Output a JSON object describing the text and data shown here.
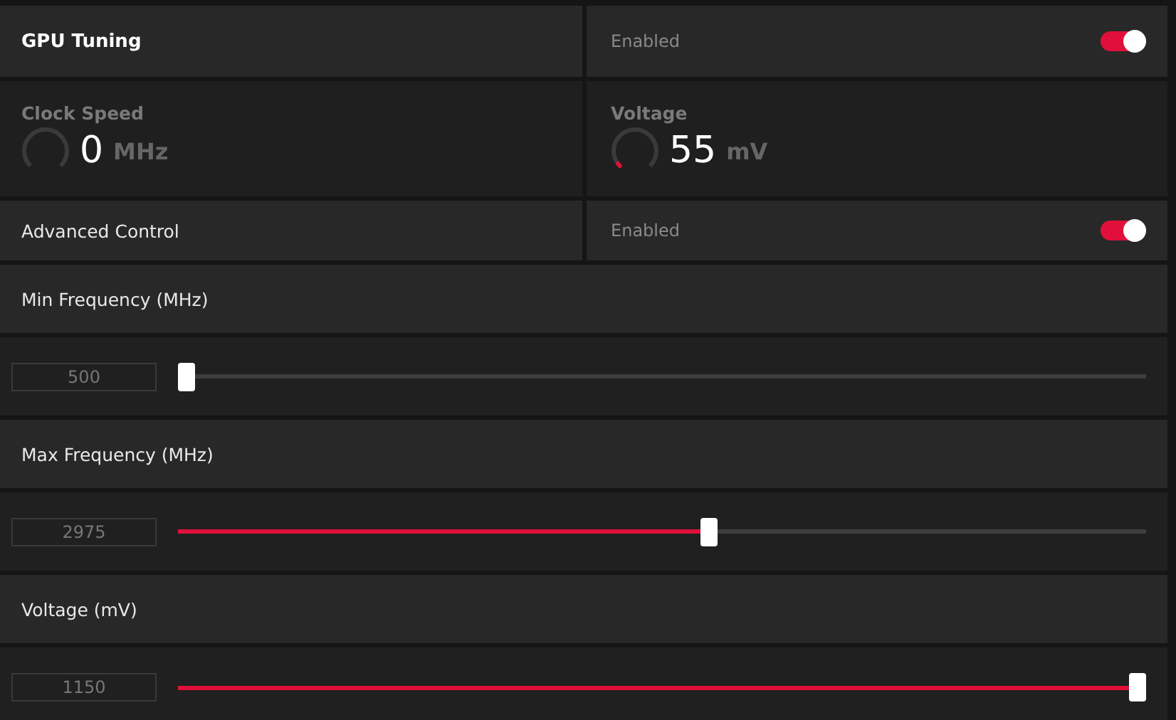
{
  "gpu_tuning": {
    "label": "GPU Tuning",
    "status": "Enabled",
    "on": true
  },
  "gauges": [
    {
      "label": "Clock Speed",
      "value": "0",
      "unit": "MHz",
      "level": 0
    },
    {
      "label": "Voltage",
      "value": "55",
      "unit": "mV",
      "level": 0.03
    }
  ],
  "advanced_control": {
    "label": "Advanced Control",
    "status": "Enabled",
    "on": true
  },
  "sliders": [
    {
      "label": "Min Frequency (MHz)",
      "value": "500",
      "level": 0
    },
    {
      "label": "Max Frequency (MHz)",
      "value": "2975",
      "level": 0.55
    },
    {
      "label": "Voltage (mV)",
      "value": "1150",
      "level": 1
    }
  ]
}
